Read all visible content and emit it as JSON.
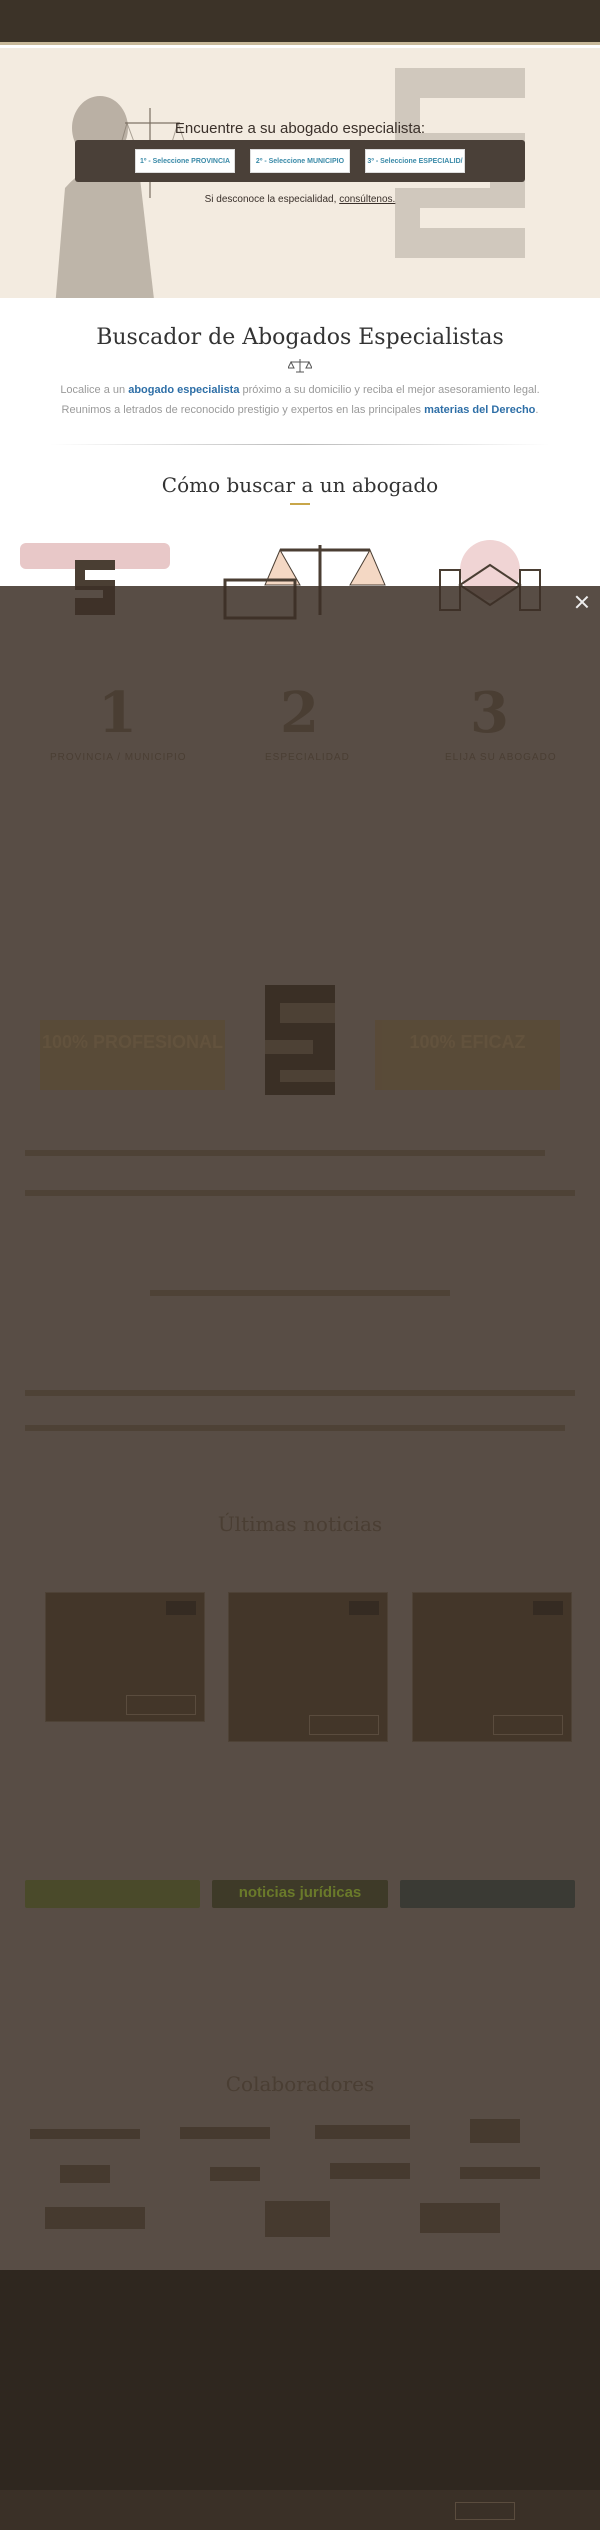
{
  "hero": {
    "title": "Encuentre a su abogado especialista:",
    "selects": [
      {
        "label": "1º - Seleccione PROVINCIA"
      },
      {
        "label": "2º - Seleccione MUNICIPIO"
      },
      {
        "label": "3º - Seleccione ESPECIALID/"
      }
    ],
    "hint_prefix": "Si desconoce la especialidad,",
    "hint_link": "consúltenos."
  },
  "intro": {
    "title": "Buscador de Abogados Especialistas",
    "line1_a": "Localice a un",
    "line1_b": "abogado especialista",
    "line1_c": "próximo a su domicilio y reciba el mejor asesoramiento legal.",
    "line2_a": "Reunimos a letrados de reconocido prestigio y expertos en las principales",
    "line2_b": "materias del Derecho",
    "line2_c": "."
  },
  "how": {
    "title": "Cómo buscar a un abogado",
    "steps": [
      {
        "num": "1",
        "label": "PROVINCIA / MUNICIPIO"
      },
      {
        "num": "2",
        "label": "ESPECIALIDAD"
      },
      {
        "num": "3",
        "label": "ELIJA SU ABOGADO"
      }
    ]
  },
  "features": {
    "left": "100% PROFESIONAL",
    "right": "100% EFICAZ"
  },
  "news": {
    "title": "Últimas noticias"
  },
  "partners": {
    "title": "Colaboradores",
    "noticias": "noticias jurídicas"
  },
  "colors": {
    "topbar": "#3c3328",
    "hero_bg": "#f3ebe0",
    "link_blue": "#2e6fa7",
    "overlay": "#3c3026",
    "accent": "#c8a64a"
  }
}
